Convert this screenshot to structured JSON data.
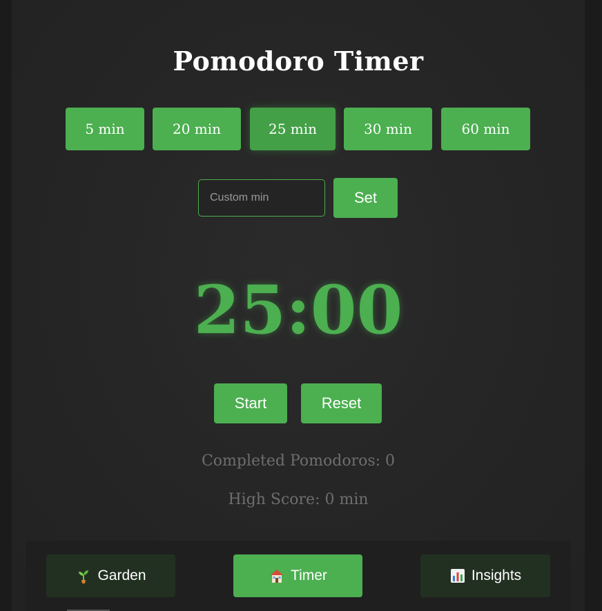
{
  "title": "Pomodoro Timer",
  "presets": [
    {
      "label": "5 min",
      "active": false
    },
    {
      "label": "20 min",
      "active": false
    },
    {
      "label": "25 min",
      "active": true
    },
    {
      "label": "30 min",
      "active": false
    },
    {
      "label": "60 min",
      "active": false
    }
  ],
  "custom": {
    "placeholder": "Custom min",
    "value": "",
    "set_label": "Set"
  },
  "timer": {
    "display": "25:00"
  },
  "controls": {
    "start_label": "Start",
    "reset_label": "Reset"
  },
  "stats": {
    "completed": "Completed Pomodoros: 0",
    "high_score": "High Score: 0 min"
  },
  "nav": {
    "items": [
      {
        "label": "Garden",
        "icon": "seedling-icon",
        "active": false
      },
      {
        "label": "Timer",
        "icon": "house-icon",
        "active": true
      },
      {
        "label": "Insights",
        "icon": "bar-chart-icon",
        "active": false
      }
    ]
  },
  "colors": {
    "accent": "#4caf50",
    "background": "#262626",
    "nav_inactive": "#223022",
    "muted_text": "#6e6e6e"
  }
}
